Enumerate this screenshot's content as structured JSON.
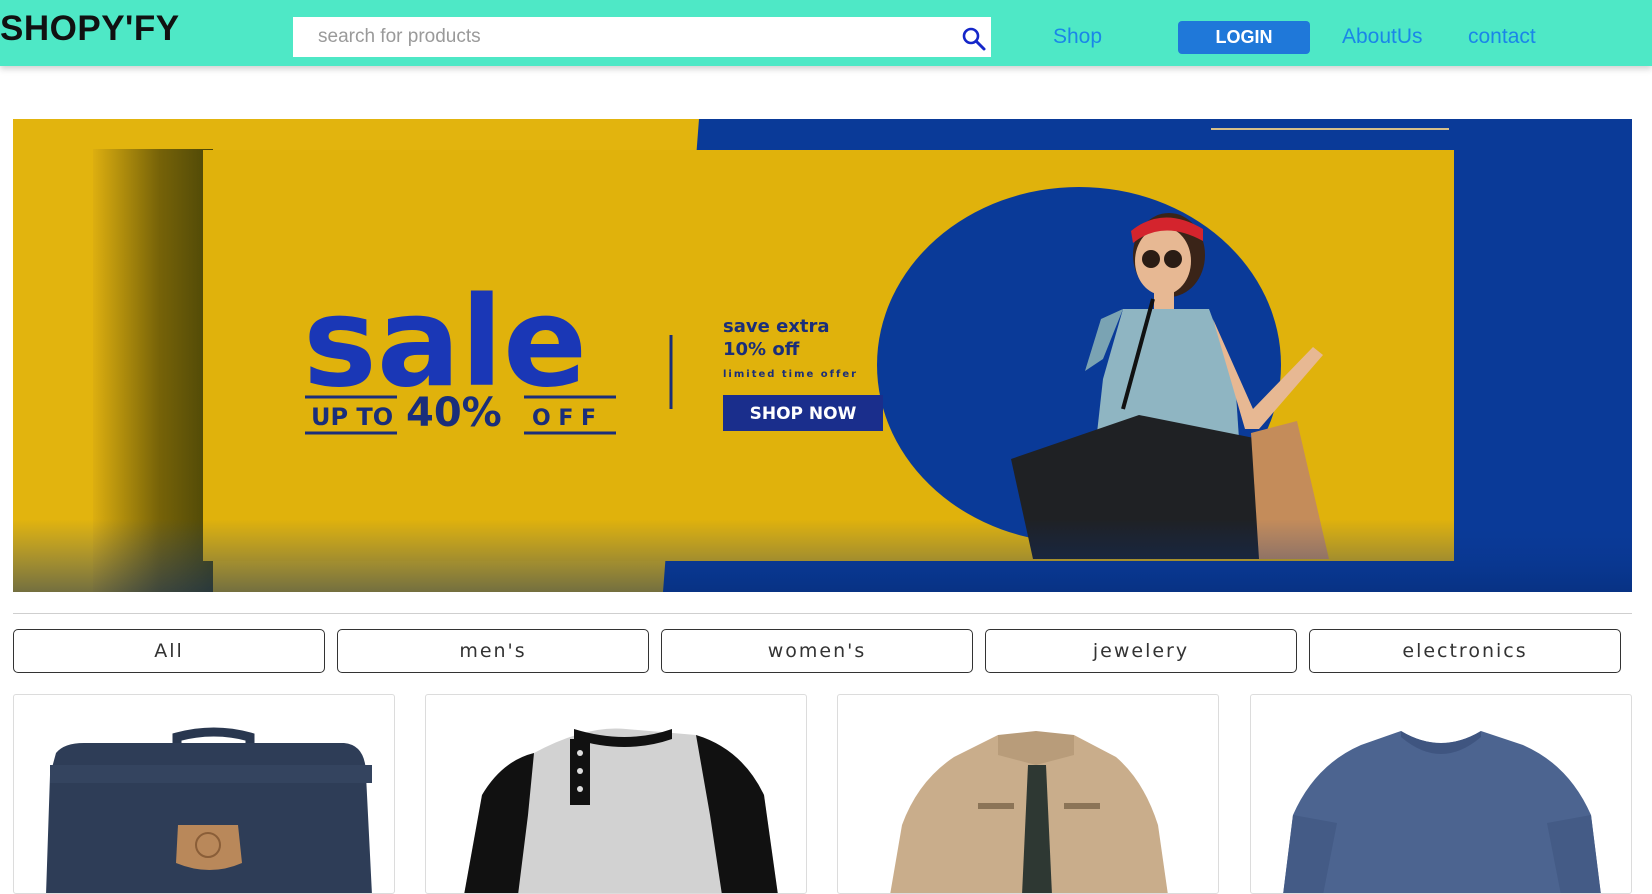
{
  "header": {
    "logo": "SHOPY'FY",
    "search_placeholder": "search for products",
    "nav": {
      "shop": "Shop",
      "login": "LOGIN",
      "about": "AboutUs",
      "contact": "contact"
    }
  },
  "banner": {
    "headline": "sale",
    "up_to": "UP TO",
    "percent": "40%",
    "off": "O F F",
    "save_line1": "save extra",
    "save_line2": "10% off",
    "limited": "limited time offer",
    "cta": "SHOP NOW"
  },
  "filters": [
    "All",
    "men's",
    "women's",
    "jewelery",
    "electronics"
  ],
  "products": [
    {
      "icon": "backpack-icon"
    },
    {
      "icon": "raglan-henley-shirt-icon"
    },
    {
      "icon": "jacket-icon"
    },
    {
      "icon": "vneck-longsleeve-icon"
    }
  ],
  "colors": {
    "header_bg": "#4ee8c6",
    "banner_yellow": "#e2b40e",
    "banner_blue": "#0a3a98",
    "link_blue": "#1a86e8",
    "login_bg": "#1f78d9"
  }
}
